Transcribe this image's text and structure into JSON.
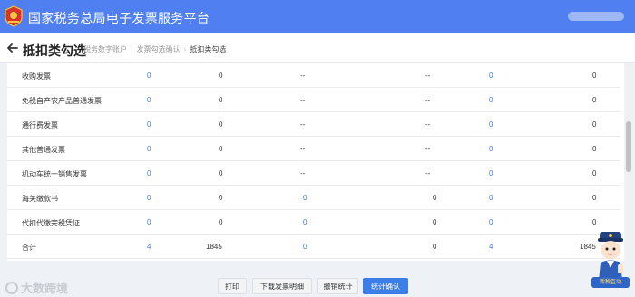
{
  "header": {
    "app_title": "国家税务总局电子发票服务平台",
    "brand_color": "#4f7ff0",
    "emblem_icon": "tax-emblem-icon"
  },
  "nav": {
    "page_title": "抵扣类勾选",
    "back_icon": "arrow-left-icon",
    "breadcrumb": [
      "税务数字账户",
      "发票勾选确认",
      "抵扣类勾选"
    ]
  },
  "table": {
    "link_color": "#3b7ee8",
    "rows": [
      {
        "name": "收购发票",
        "c1": "0",
        "c2": "0",
        "c3": "--",
        "c4": "--",
        "c5": "0",
        "c6": "0"
      },
      {
        "name": "免税自产农产品普通发票",
        "c1": "0",
        "c2": "0",
        "c3": "--",
        "c4": "--",
        "c5": "0",
        "c6": "0"
      },
      {
        "name": "通行费发票",
        "c1": "0",
        "c2": "0",
        "c3": "--",
        "c4": "--",
        "c5": "0",
        "c6": "0"
      },
      {
        "name": "其他普通发票",
        "c1": "0",
        "c2": "0",
        "c3": "--",
        "c4": "--",
        "c5": "0",
        "c6": "0"
      },
      {
        "name": "机动车统一销售发票",
        "c1": "0",
        "c2": "0",
        "c3": "--",
        "c4": "--",
        "c5": "0",
        "c6": "0"
      },
      {
        "name": "海关缴款书",
        "c1": "0",
        "c2": "0",
        "c3": "0",
        "c4": "0",
        "c5": "0",
        "c6": "0"
      },
      {
        "name": "代扣代缴完税凭证",
        "c1": "0",
        "c2": "0",
        "c3": "0",
        "c4": "0",
        "c5": "0",
        "c6": "0"
      },
      {
        "name": "合计",
        "c1": "4",
        "c2": "1845",
        "c3": "0",
        "c4": "0",
        "c5": "4",
        "c6": "1845"
      }
    ]
  },
  "footer": {
    "print_label": "打印",
    "download_label": "下载发票明细",
    "revoke_label": "撤销统计",
    "confirm_label": "统计确认"
  },
  "watermark": {
    "text": "大数跨境"
  },
  "mascot": {
    "label": "新税互动"
  }
}
